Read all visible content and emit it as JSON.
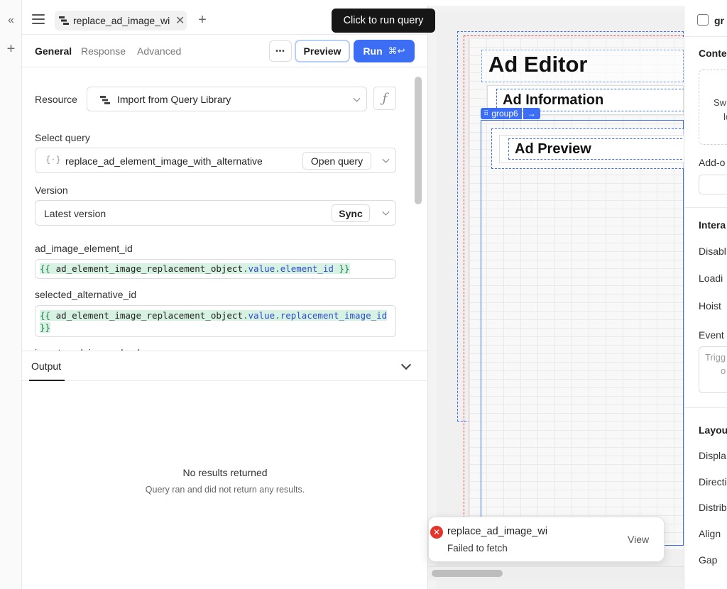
{
  "rail": {
    "collapse_glyph": "«",
    "add_glyph": "+"
  },
  "query_tab": {
    "label": "replace_ad_image_wi",
    "close_glyph": "✕",
    "new_tab_glyph": "+"
  },
  "subtabs": {
    "general": "General",
    "response": "Response",
    "advanced": "Advanced"
  },
  "toolbar": {
    "more_glyph": "•••",
    "preview_label": "Preview",
    "run_label": "Run",
    "run_shortcut": "⌘↩",
    "tooltip": "Click to run query"
  },
  "form": {
    "resource_label": "Resource",
    "resource_value": "Import from Query Library",
    "fx_glyph": "ƒ",
    "select_query_label": "Select query",
    "select_query_value": "replace_ad_element_image_with_alternative",
    "open_query_label": "Open query",
    "version_label": "Version",
    "version_value": "Latest version",
    "sync_label": "Sync",
    "param1_label": "ad_image_element_id",
    "param1_open": "{{ ",
    "param1_var": "ad_element_image_replacement_object",
    "param1_dot1": ".",
    "param1_prop1": "value",
    "param1_dot2": ".",
    "param1_prop2": "element_id",
    "param1_close": " }}",
    "param2_label": "selected_alternative_id",
    "param2_open": "{{ ",
    "param2_var": "ad_element_image_replacement_object",
    "param2_dot1": ".",
    "param2_prop1": "value",
    "param2_dot2": ".",
    "param2_prop2": "replacement_image_id",
    "param2_close": "}}",
    "param3_label": "is_external_image_boolean"
  },
  "output": {
    "tab_label": "Output",
    "empty_title": "No results returned",
    "empty_sub": "Query ran and did not return any results."
  },
  "canvas": {
    "title": "Ad Editor",
    "section1": "Ad Information",
    "group_badge": "group6",
    "group_arrow": "→",
    "section2": "Ad Preview"
  },
  "inspector": {
    "title_partial": "gr",
    "content_partial": "Conte",
    "swap_partial": "Sw",
    "swap_partial2": "lo",
    "addon_partial": "Add-o",
    "interaction_partial": "Intera",
    "disable_partial": "Disabl",
    "loading_partial": "Loadi",
    "hoist_partial": "Hoist",
    "event_partial": "Event",
    "trigger_partial": "Trigg",
    "trigger_partial2": "o",
    "layout_partial": "Layou",
    "display_partial": "Displa",
    "direction_partial": "Directi",
    "distribute_partial": "Distrib",
    "align_partial": "Align",
    "gap_partial": "Gap"
  },
  "toast": {
    "error_glyph": "✕",
    "title": "replace_ad_image_wi",
    "message": "Failed to fetch",
    "view_label": "View"
  },
  "colors": {
    "primary": "#3b6ef5",
    "error": "#e5342b",
    "code_highlight_bg": "#d7f1e2",
    "selection_blue": "#3b6ef5"
  }
}
